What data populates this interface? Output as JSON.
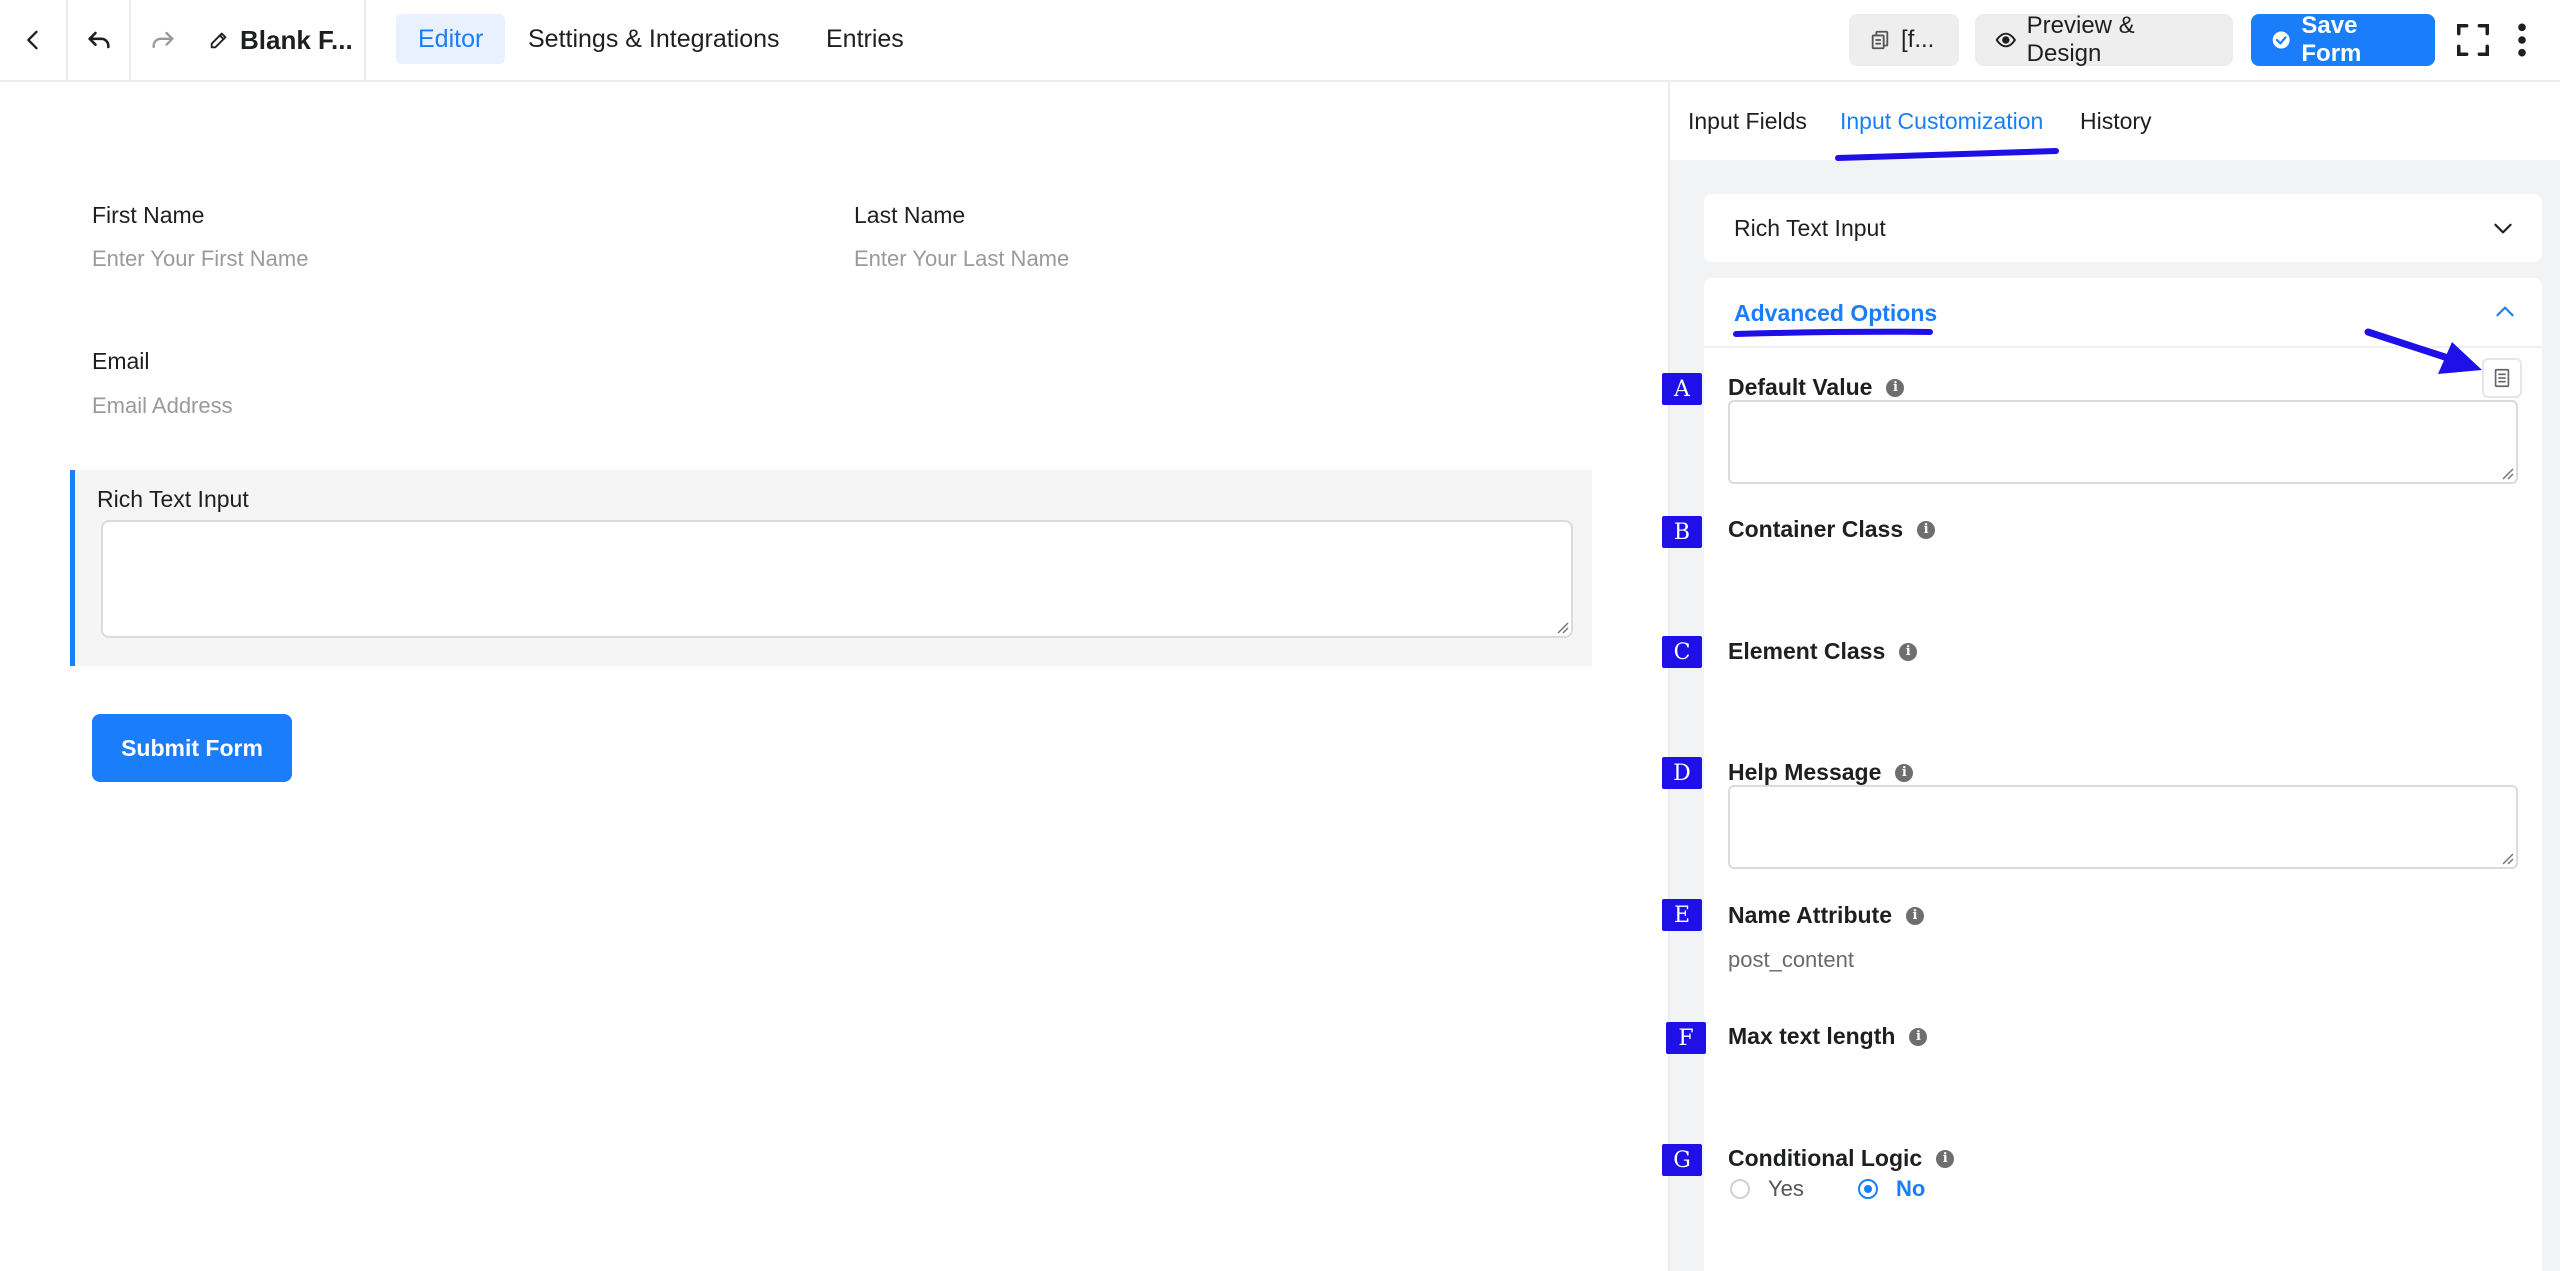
{
  "topbar": {
    "form_name": "Blank F...",
    "tabs": [
      {
        "label": "Editor"
      },
      {
        "label": "Settings & Integrations"
      },
      {
        "label": "Entries"
      }
    ],
    "shortcode_label": "[f...",
    "preview_label": "Preview & Design",
    "save_label": "Save Form"
  },
  "canvas": {
    "first_name": {
      "label": "First Name",
      "placeholder": "Enter Your First Name"
    },
    "last_name": {
      "label": "Last Name",
      "placeholder": "Enter Your Last Name"
    },
    "email": {
      "label": "Email",
      "placeholder": "Email Address"
    },
    "rich_text": {
      "label": "Rich Text Input"
    },
    "submit_label": "Submit Form"
  },
  "panel": {
    "tabs": [
      {
        "label": "Input Fields"
      },
      {
        "label": "Input Customization"
      },
      {
        "label": "History"
      }
    ],
    "section_title": "Rich Text Input",
    "advanced_title": "Advanced Options",
    "options": {
      "default_value": "Default Value",
      "container_class": "Container Class",
      "element_class": "Element Class",
      "help_message": "Help Message",
      "name_attribute": "Name Attribute",
      "name_attribute_value": "post_content",
      "max_text_length": "Max text length",
      "conditional_logic": "Conditional Logic",
      "yes_label": "Yes",
      "no_label": "No"
    }
  },
  "annotations": {
    "badges": [
      "A",
      "B",
      "C",
      "D",
      "E",
      "F",
      "G"
    ],
    "color": "#1f10e8"
  },
  "colors": {
    "accent": "#1a7efb",
    "annotation": "#1f10e8"
  }
}
